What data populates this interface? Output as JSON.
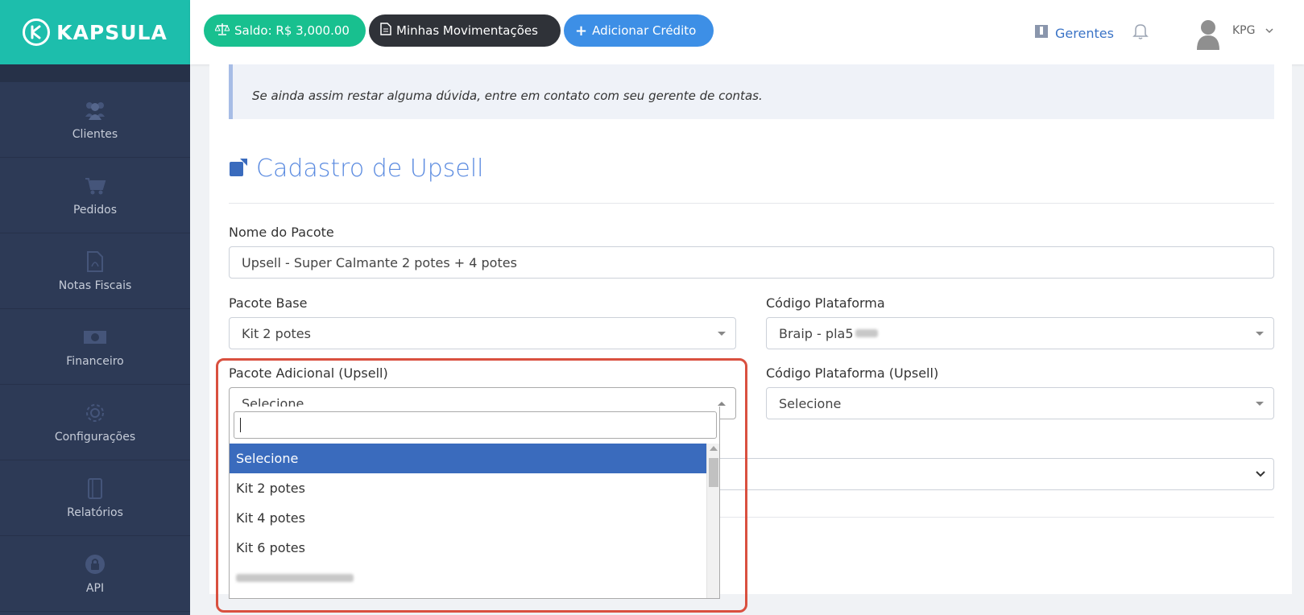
{
  "brand": {
    "name": "KAPSULA",
    "color": "#1dbeac"
  },
  "sidebar": {
    "items": [
      {
        "label": "Clientes",
        "icon": "users-icon"
      },
      {
        "label": "Pedidos",
        "icon": "cart-icon"
      },
      {
        "label": "Notas Fiscais",
        "icon": "pdf-file-icon"
      },
      {
        "label": "Financeiro",
        "icon": "money-bill-icon"
      },
      {
        "label": "Configurações",
        "icon": "gear-icon"
      },
      {
        "label": "Relatórios",
        "icon": "notebook-icon"
      },
      {
        "label": "API",
        "icon": "lock-icon"
      }
    ]
  },
  "topbar": {
    "saldo": "Saldo: R$ 3,000.00",
    "movimentacoes": "Minhas Movimentações",
    "adicionar": "Adicionar Crédito",
    "gerentes": "Gerentes",
    "user": "KPG"
  },
  "notice": {
    "text": "Se ainda assim restar alguma dúvida, entre em contato com seu gerente de contas."
  },
  "form": {
    "title": "Cadastro de Upsell",
    "nome_label": "Nome do Pacote",
    "nome_value": "Upsell - Super Calmante 2 potes + 4 potes",
    "base_label": "Pacote Base",
    "base_value": "Kit 2 potes",
    "codigo_label": "Código Plataforma",
    "codigo_value": "Braip - pla5",
    "adicional_label": "Pacote Adicional (Upsell)",
    "adicional_value": "Selecione",
    "codigo_upsell_label": "Código Plataforma (Upsell)",
    "codigo_upsell_value": "Selecione"
  },
  "dropdown": {
    "options": [
      "Selecione",
      "Kit 2 potes",
      "Kit 4 potes",
      "Kit 6 potes"
    ],
    "selected": "Selecione"
  },
  "colors": {
    "accent": "#3a6bbd",
    "highlight": "#d9503f",
    "sidebar": "#2d3a56"
  }
}
